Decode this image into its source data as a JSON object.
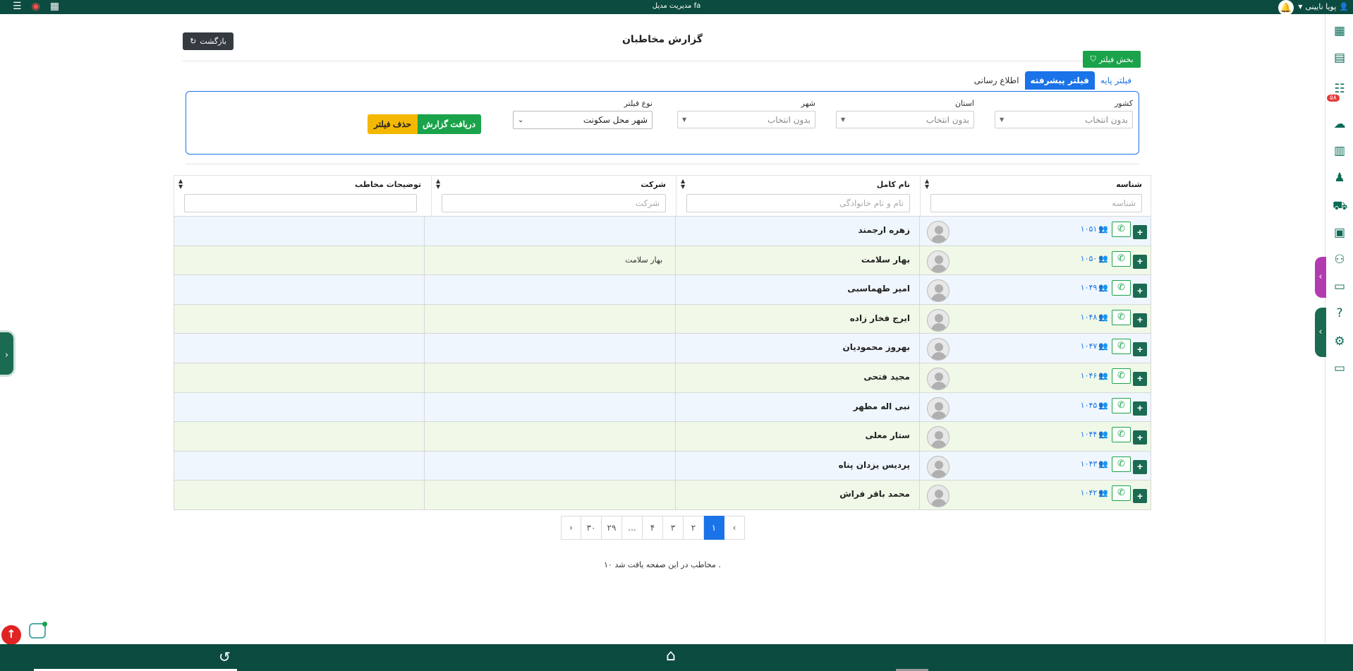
{
  "topbar": {
    "title": "مدیریت مدیل fa",
    "user_name": "پویا نایینی",
    "icons": [
      "menu-list-icon",
      "logo-icon",
      "calendar-icon"
    ]
  },
  "header": {
    "page_title": "گزارش مخاطبان",
    "back_label": "بازگشت",
    "filter_toggle_label": "بخش فیلتر"
  },
  "tabs": [
    {
      "label": "فیلتر پایه",
      "active": false
    },
    {
      "label": "فیلتر پیشرفته",
      "active": true
    },
    {
      "label": "اطلاع رسانی",
      "active": false
    }
  ],
  "filters": {
    "country": {
      "label": "کشور",
      "placeholder": "بدون انتخاب"
    },
    "province": {
      "label": "استان",
      "placeholder": "بدون انتخاب"
    },
    "city": {
      "label": "شهر",
      "placeholder": "بدون انتخاب"
    },
    "type": {
      "label": "نوع فیلتر",
      "value": "شهر محل سکونت"
    },
    "report_button": "دریافت گزارش",
    "delete_button": "حذف فیلتر"
  },
  "table": {
    "columns": [
      {
        "title": "شناسه",
        "placeholder": "شناسه"
      },
      {
        "title": "نام کامل",
        "placeholder": "نام و نام خانوادگی"
      },
      {
        "title": "شرکت",
        "placeholder": "شرکت"
      },
      {
        "title": "توضیحات مخاطب",
        "placeholder": ""
      }
    ],
    "rows": [
      {
        "id": "۱۰۵۱",
        "name": "زهره ارجمند",
        "company": ""
      },
      {
        "id": "۱۰۵۰",
        "name": "بهار سلامت",
        "company": "بهار سلامت"
      },
      {
        "id": "۱۰۴۹",
        "name": "امیر طهماسبی",
        "company": ""
      },
      {
        "id": "۱۰۴۸",
        "name": "ایرج فخار زاده",
        "company": ""
      },
      {
        "id": "۱۰۴۷",
        "name": "بهروز محمودیان",
        "company": ""
      },
      {
        "id": "۱۰۴۶",
        "name": "مجید فتحی",
        "company": ""
      },
      {
        "id": "۱۰۴۵",
        "name": "نبی اله مطهر",
        "company": ""
      },
      {
        "id": "۱۰۴۴",
        "name": "ستار معلی",
        "company": ""
      },
      {
        "id": "۱۰۴۳",
        "name": "پردیس یزدان پناه",
        "company": ""
      },
      {
        "id": "۱۰۴۲",
        "name": "محمد باقر فراش",
        "company": ""
      }
    ]
  },
  "pagination": {
    "prev": "‹",
    "pages": [
      "۱",
      "۲",
      "۳",
      "۴",
      "...",
      "۲۹",
      "۳۰"
    ],
    "next": "›",
    "current": "۱"
  },
  "footer_text": "۱۰ مخاطب در این صفحه یافت شد .",
  "sidebar_badge": "۵۸",
  "colors": {
    "primary_green": "#0c4b3f",
    "accent_blue": "#1a73e8",
    "success": "#1aa34a",
    "warning": "#f5b800"
  }
}
